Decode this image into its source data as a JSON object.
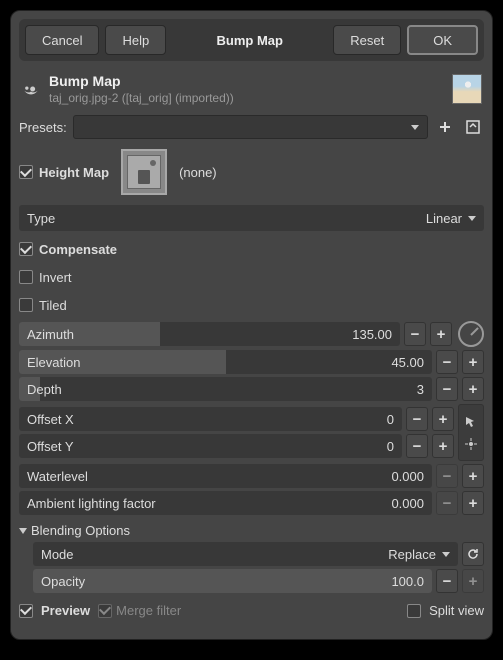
{
  "title": "Bump Map",
  "buttons": {
    "cancel": "Cancel",
    "help": "Help",
    "reset": "Reset",
    "ok": "OK"
  },
  "header": {
    "title": "Bump Map",
    "subtitle": "taj_orig.jpg-2 ([taj_orig] (imported))"
  },
  "presets_label": "Presets:",
  "heightmap": {
    "label": "Height Map",
    "value": "(none)"
  },
  "type": {
    "label": "Type",
    "value": "Linear"
  },
  "compensate": "Compensate",
  "invert": "Invert",
  "tiled": "Tiled",
  "sliders": {
    "azimuth": {
      "label": "Azimuth",
      "value": "135.00",
      "fill": 37
    },
    "elevation": {
      "label": "Elevation",
      "value": "45.00",
      "fill": 50
    },
    "depth": {
      "label": "Depth",
      "value": "3",
      "fill": 5
    },
    "offsetx": {
      "label": "Offset X",
      "value": "0"
    },
    "offsety": {
      "label": "Offset Y",
      "value": "0"
    },
    "water": {
      "label": "Waterlevel",
      "value": "0.000"
    },
    "ambient": {
      "label": "Ambient lighting factor",
      "value": "0.000"
    }
  },
  "blending": {
    "title": "Blending Options",
    "mode_label": "Mode",
    "mode_value": "Replace",
    "opacity_label": "Opacity",
    "opacity_value": "100.0"
  },
  "footer": {
    "preview": "Preview",
    "merge": "Merge filter",
    "split": "Split view"
  }
}
